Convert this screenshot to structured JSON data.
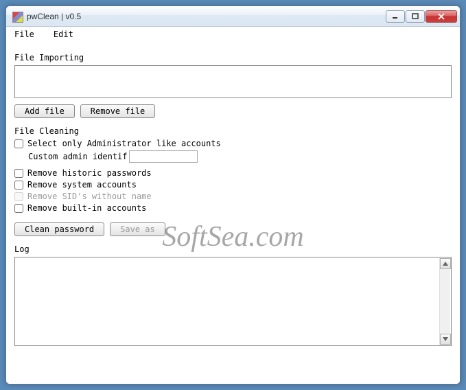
{
  "window": {
    "title": "pwClean | v0.5"
  },
  "menu": {
    "file": "File",
    "edit": "Edit"
  },
  "importing": {
    "label": "File Importing",
    "add_btn": "Add file",
    "remove_btn": "Remove file"
  },
  "cleaning": {
    "label": "File Cleaning",
    "select_admin": "Select only Administrator like accounts",
    "custom_admin_label": "Custom admin identif",
    "custom_admin_value": "",
    "remove_historic": "Remove historic passwords",
    "remove_system": "Remove system accounts",
    "remove_sid": "Remove SID's without name",
    "remove_builtin": "Remove built-in accounts",
    "clean_btn": "Clean password",
    "saveas_btn": "Save as"
  },
  "log": {
    "label": "Log"
  },
  "watermark": "SoftSea.com"
}
